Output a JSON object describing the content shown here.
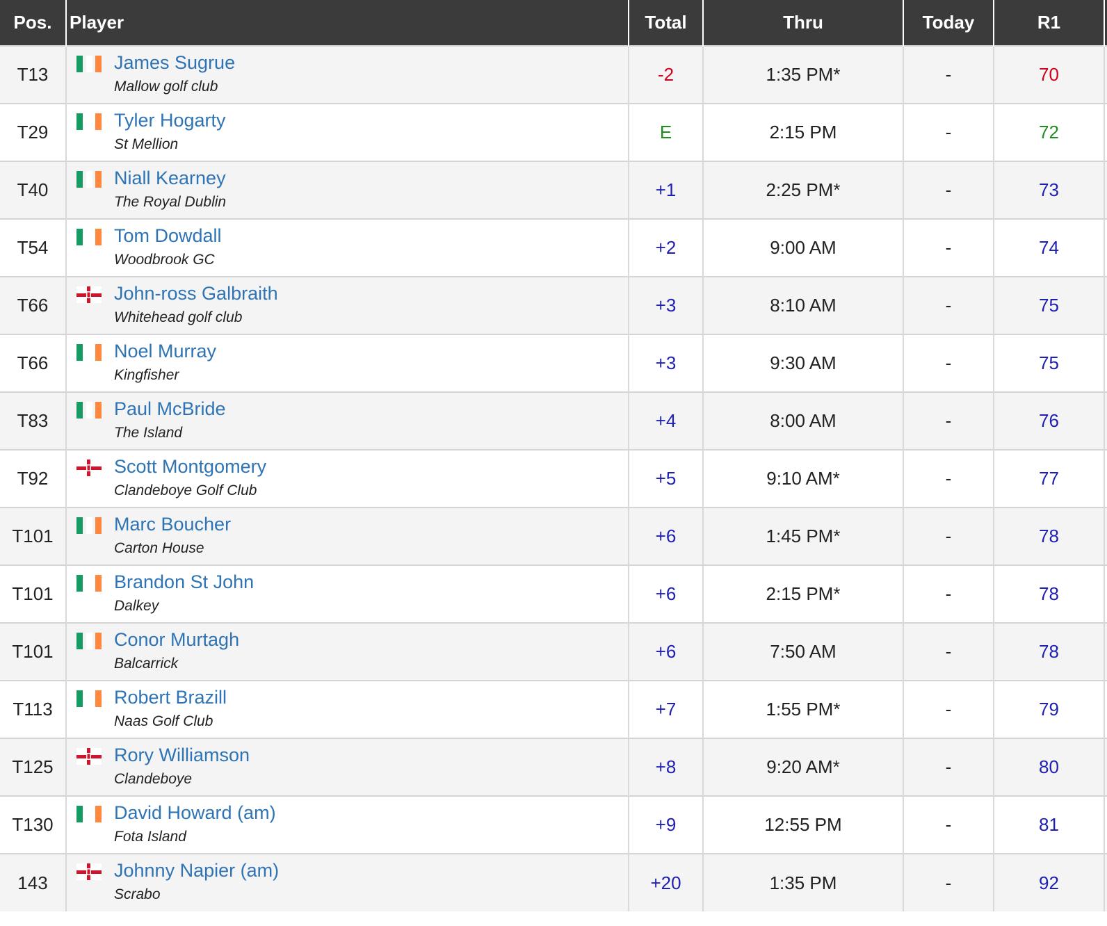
{
  "colors": {
    "header_bg": "#3b3b3b",
    "name_link": "#2e74b5",
    "under_par": "#d0021b",
    "even_par": "#1e8e1e",
    "over_par": "#1f1fb4",
    "flag_ireland": [
      "#169b62",
      "#ffffff",
      "#ff883e"
    ],
    "flag_northern_ireland": [
      "#ffffff",
      "#cf142b"
    ]
  },
  "table": {
    "headers": {
      "pos": "Pos.",
      "player": "Player",
      "total": "Total",
      "thru": "Thru",
      "today": "Today",
      "r1": "R1"
    },
    "rows": [
      {
        "pos": "T13",
        "flag": "ireland-flag-icon",
        "name": "James Sugrue",
        "club": "Mallow golf club",
        "total": "-2",
        "thru": "1:35 PM*",
        "today": "-",
        "r1": "70",
        "status": "under"
      },
      {
        "pos": "T29",
        "flag": "ireland-flag-icon",
        "name": "Tyler Hogarty",
        "club": "St Mellion",
        "total": "E",
        "thru": "2:15 PM",
        "today": "-",
        "r1": "72",
        "status": "even"
      },
      {
        "pos": "T40",
        "flag": "ireland-flag-icon",
        "name": "Niall Kearney",
        "club": "The Royal Dublin",
        "total": "+1",
        "thru": "2:25 PM*",
        "today": "-",
        "r1": "73",
        "status": "over"
      },
      {
        "pos": "T54",
        "flag": "ireland-flag-icon",
        "name": "Tom Dowdall",
        "club": "Woodbrook GC",
        "total": "+2",
        "thru": "9:00 AM",
        "today": "-",
        "r1": "74",
        "status": "over"
      },
      {
        "pos": "T66",
        "flag": "northern-ireland-flag-icon",
        "name": "John-ross Galbraith",
        "club": "Whitehead golf club",
        "total": "+3",
        "thru": "8:10 AM",
        "today": "-",
        "r1": "75",
        "status": "over"
      },
      {
        "pos": "T66",
        "flag": "ireland-flag-icon",
        "name": "Noel Murray",
        "club": "Kingfisher",
        "total": "+3",
        "thru": "9:30 AM",
        "today": "-",
        "r1": "75",
        "status": "over"
      },
      {
        "pos": "T83",
        "flag": "ireland-flag-icon",
        "name": "Paul McBride",
        "club": "The Island",
        "total": "+4",
        "thru": "8:00 AM",
        "today": "-",
        "r1": "76",
        "status": "over"
      },
      {
        "pos": "T92",
        "flag": "northern-ireland-flag-icon",
        "name": "Scott Montgomery",
        "club": "Clandeboye Golf Club",
        "total": "+5",
        "thru": "9:10 AM*",
        "today": "-",
        "r1": "77",
        "status": "over"
      },
      {
        "pos": "T101",
        "flag": "ireland-flag-icon",
        "name": "Marc Boucher",
        "club": "Carton House",
        "total": "+6",
        "thru": "1:45 PM*",
        "today": "-",
        "r1": "78",
        "status": "over"
      },
      {
        "pos": "T101",
        "flag": "ireland-flag-icon",
        "name": "Brandon St John",
        "club": "Dalkey",
        "total": "+6",
        "thru": "2:15 PM*",
        "today": "-",
        "r1": "78",
        "status": "over"
      },
      {
        "pos": "T101",
        "flag": "ireland-flag-icon",
        "name": "Conor Murtagh",
        "club": "Balcarrick",
        "total": "+6",
        "thru": "7:50 AM",
        "today": "-",
        "r1": "78",
        "status": "over"
      },
      {
        "pos": "T113",
        "flag": "ireland-flag-icon",
        "name": "Robert Brazill",
        "club": "Naas Golf Club",
        "total": "+7",
        "thru": "1:55 PM*",
        "today": "-",
        "r1": "79",
        "status": "over"
      },
      {
        "pos": "T125",
        "flag": "northern-ireland-flag-icon",
        "name": "Rory Williamson",
        "club": "Clandeboye",
        "total": "+8",
        "thru": "9:20 AM*",
        "today": "-",
        "r1": "80",
        "status": "over"
      },
      {
        "pos": "T130",
        "flag": "ireland-flag-icon",
        "name": "David Howard (am)",
        "club": "Fota Island",
        "total": "+9",
        "thru": "12:55 PM",
        "today": "-",
        "r1": "81",
        "status": "over"
      },
      {
        "pos": "143",
        "flag": "northern-ireland-flag-icon",
        "name": "Johnny Napier (am)",
        "club": "Scrabo",
        "total": "+20",
        "thru": "1:35 PM",
        "today": "-",
        "r1": "92",
        "status": "over"
      }
    ]
  }
}
